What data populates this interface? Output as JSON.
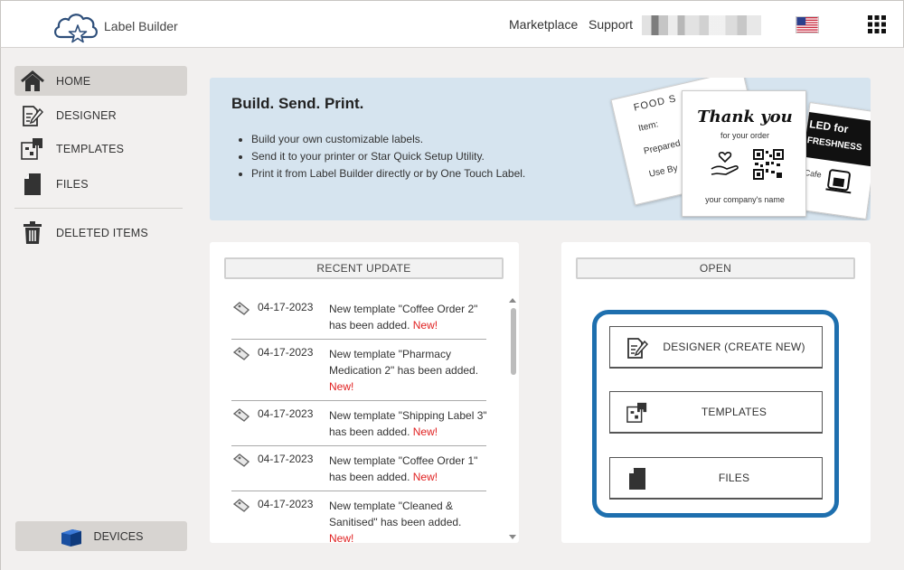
{
  "header": {
    "app_name": "Label Builder",
    "nav": [
      "Marketplace",
      "Support"
    ]
  },
  "sidebar": {
    "items": [
      {
        "label": "HOME",
        "icon": "home-icon",
        "active": true
      },
      {
        "label": "DESIGNER",
        "icon": "designer-icon"
      },
      {
        "label": "TEMPLATES",
        "icon": "templates-icon"
      },
      {
        "label": "FILES",
        "icon": "file-icon"
      },
      {
        "label": "DELETED ITEMS",
        "icon": "trash-icon"
      }
    ],
    "devices_label": "DEVICES"
  },
  "banner": {
    "title": "Build. Send. Print.",
    "bullets": [
      "Build your own customizable labels.",
      "Send it to your printer or Star Quick Setup Utility.",
      "Print it from Label Builder directly or by One Touch Label."
    ],
    "illustration": {
      "food_label": {
        "title": "FOOD S",
        "lines": [
          "Item:",
          "Prepared",
          "Use By"
        ]
      },
      "black_label": {
        "lines": [
          "LED for",
          "FRESHNESS"
        ],
        "footer": "Cafe"
      },
      "thanks_label": {
        "title": "Thank you",
        "subtitle": "for your order",
        "footer": "your company's name"
      }
    }
  },
  "recent_update": {
    "title": "RECENT UPDATE",
    "items": [
      {
        "date": "04-17-2023",
        "text": "New template \"Coffee Order 2\" has been added.",
        "badge": "New!"
      },
      {
        "date": "04-17-2023",
        "text": "New template \"Pharmacy Medication 2\" has been added.",
        "badge": "New!"
      },
      {
        "date": "04-17-2023",
        "text": "New template \"Shipping Label 3\" has been added.",
        "badge": "New!"
      },
      {
        "date": "04-17-2023",
        "text": "New template \"Coffee Order 1\" has been added.",
        "badge": "New!"
      },
      {
        "date": "04-17-2023",
        "text": "New template \"Cleaned & Sanitised\" has been added.",
        "badge": "New!"
      }
    ]
  },
  "open": {
    "title": "OPEN",
    "buttons": [
      {
        "label": "DESIGNER (CREATE NEW)",
        "icon": "designer-icon"
      },
      {
        "label": "TEMPLATES",
        "icon": "templates-icon"
      },
      {
        "label": "FILES",
        "icon": "file-icon"
      }
    ]
  },
  "colors": {
    "accent": "#1e6fae",
    "new_badge": "#e02020",
    "banner_bg": "#d6e4ef"
  }
}
